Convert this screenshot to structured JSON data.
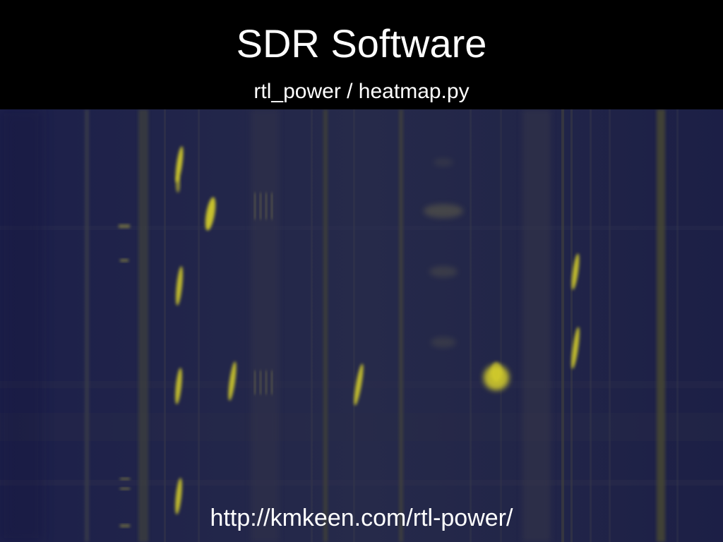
{
  "slide": {
    "title": "SDR Software",
    "subtitle": "rtl_power / heatmap.py",
    "url": "http://kmkeen.com/rtl-power/"
  },
  "colors": {
    "background": "#000000",
    "heatmap_base": "#22224a",
    "signal": "#e6e02a",
    "text": "#ffffff"
  }
}
